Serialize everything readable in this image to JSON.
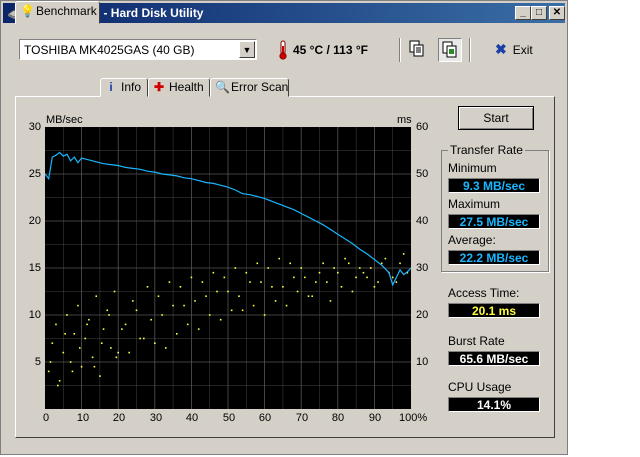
{
  "window": {
    "title": "HD Tune 2.00 - Hard Disk Utility",
    "controls": {
      "minimize": "_",
      "maximize": "□",
      "close": "✕"
    }
  },
  "toolbar": {
    "drive_select": "TOSHIBA MK4025GAS (40 GB)",
    "temperature": "45 °C / 113 °F",
    "exit_label": "Exit"
  },
  "tabs": [
    {
      "label": "Benchmark",
      "icon": "lightbulb-icon"
    },
    {
      "label": "Info",
      "icon": "info-icon"
    },
    {
      "label": "Health",
      "icon": "red-cross-icon"
    },
    {
      "label": "Error Scan",
      "icon": "magnifier-icon"
    }
  ],
  "benchmark": {
    "start_label": "Start",
    "transfer_rate": {
      "group_title": "Transfer Rate",
      "minimum_label": "Minimum",
      "minimum_value": "9.3 MB/sec",
      "maximum_label": "Maximum",
      "maximum_value": "27.5 MB/sec",
      "average_label": "Average:",
      "average_value": "22.2 MB/sec"
    },
    "access_time_label": "Access Time:",
    "access_time_value": "20.1 ms",
    "burst_rate_label": "Burst Rate",
    "burst_rate_value": "65.6 MB/sec",
    "cpu_usage_label": "CPU Usage",
    "cpu_usage_value": "14.1%"
  },
  "colors": {
    "transfer_line": "#19b7ff",
    "access_points": "#ffff40",
    "plot_bg": "#000000",
    "grid": "#555555"
  },
  "chart_data": {
    "type": "line",
    "title": "",
    "ylabel": "MB/sec",
    "y2label": "ms",
    "ylim": [
      0,
      30
    ],
    "y2lim": [
      0,
      60
    ],
    "xlim": [
      0,
      100
    ],
    "x_ticks": [
      "0",
      "10",
      "20",
      "30",
      "40",
      "50",
      "60",
      "70",
      "80",
      "90",
      "100%"
    ],
    "y_ticks": [
      "30",
      "25",
      "20",
      "15",
      "10",
      "5"
    ],
    "y2_ticks": [
      "60",
      "50",
      "40",
      "30",
      "20",
      "10"
    ],
    "grid": true,
    "series": [
      {
        "kind": "transfer_rate",
        "x": [
          0,
          1,
          2,
          3,
          4,
          5,
          6,
          7,
          8,
          9,
          10,
          12,
          14,
          16,
          18,
          20,
          22,
          24,
          26,
          28,
          30,
          32,
          34,
          36,
          38,
          40,
          42,
          44,
          46,
          48,
          50,
          52,
          53,
          54,
          56,
          58,
          60,
          62,
          64,
          66,
          68,
          70,
          72,
          74,
          76,
          78,
          80,
          82,
          84,
          86,
          88,
          90,
          92,
          93,
          94,
          95,
          96,
          97,
          98,
          99,
          100
        ],
        "y": [
          25.0,
          24.5,
          26.8,
          27.0,
          27.3,
          26.9,
          27.1,
          26.4,
          26.8,
          26.2,
          26.7,
          26.5,
          26.3,
          26.1,
          26.0,
          25.9,
          25.7,
          25.6,
          25.5,
          25.3,
          25.2,
          25.0,
          24.9,
          24.8,
          24.6,
          24.5,
          24.3,
          24.1,
          24.0,
          23.8,
          23.6,
          23.3,
          23.1,
          22.9,
          22.8,
          22.6,
          22.4,
          22.1,
          21.8,
          21.5,
          21.2,
          20.8,
          20.4,
          20.0,
          19.6,
          19.1,
          18.6,
          18.1,
          17.6,
          17.0,
          16.5,
          15.9,
          15.3,
          14.9,
          14.5,
          13.2,
          14.0,
          14.8,
          14.3,
          14.6,
          15.0
        ]
      },
      {
        "kind": "access_time_scatter",
        "x": [
          1,
          2,
          3,
          4,
          5,
          6,
          7,
          8,
          9,
          10,
          11,
          12,
          13,
          14,
          15,
          16,
          17,
          18,
          19,
          20,
          22,
          24,
          26,
          28,
          30,
          32,
          34,
          36,
          38,
          40,
          42,
          44,
          46,
          48,
          50,
          52,
          54,
          56,
          58,
          60,
          62,
          64,
          66,
          68,
          70,
          72,
          74,
          76,
          78,
          80,
          82,
          84,
          86,
          88,
          90,
          92,
          94,
          96,
          98,
          1.5,
          3.5,
          5.5,
          7.5,
          9.5,
          11.5,
          13.5,
          15.5,
          17.5,
          19.5,
          21,
          23,
          25,
          27,
          29,
          31,
          33,
          35,
          37,
          39,
          41,
          43,
          45,
          47,
          49,
          51,
          53,
          55,
          57,
          59,
          61,
          63,
          65,
          67,
          69,
          71,
          73,
          75,
          77,
          79,
          81,
          83,
          85,
          87,
          89,
          91,
          93,
          95,
          97,
          99
        ],
        "y": [
          8,
          14,
          18,
          6,
          12,
          20,
          10,
          16,
          22,
          9,
          15,
          19,
          11,
          24,
          7,
          17,
          21,
          13,
          25,
          12,
          18,
          23,
          15,
          26,
          14,
          20,
          27,
          16,
          22,
          28,
          17,
          24,
          29,
          19,
          25,
          30,
          21,
          27,
          31,
          20,
          26,
          32,
          22,
          28,
          30,
          24,
          27,
          31,
          23,
          29,
          32,
          25,
          30,
          28,
          26,
          31,
          29,
          27,
          33,
          10,
          5,
          16,
          8,
          13,
          18,
          9,
          14,
          20,
          11,
          17,
          12,
          21,
          15,
          19,
          24,
          13,
          22,
          26,
          18,
          23,
          27,
          20,
          25,
          28,
          21,
          24,
          29,
          22,
          27,
          30,
          23,
          26,
          31,
          25,
          28,
          24,
          29,
          27,
          30,
          26,
          31,
          28,
          29,
          30,
          27,
          32,
          28,
          31,
          29
        ]
      }
    ]
  }
}
